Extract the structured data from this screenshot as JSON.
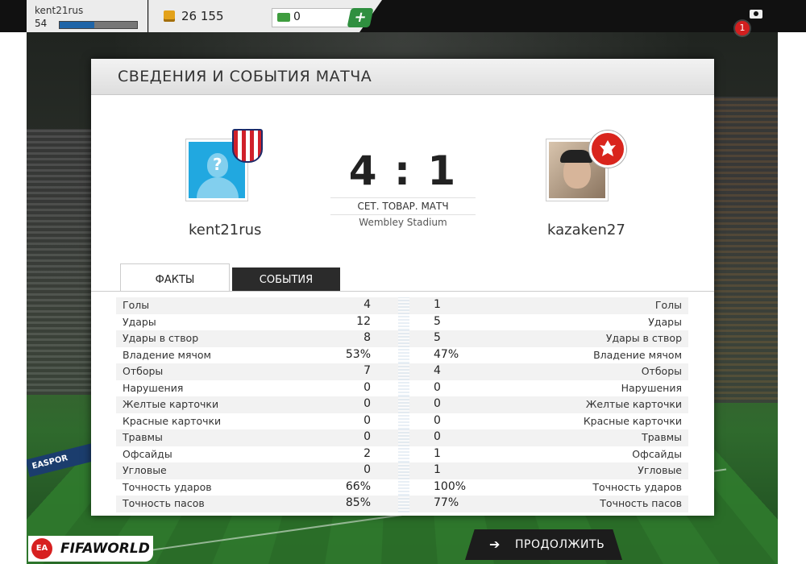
{
  "topbar": {
    "username": "kent21rus",
    "level": "54",
    "xp_fraction": 0.45,
    "coins": "26 155",
    "cash": "0",
    "add_label": "+",
    "notification_count": "1",
    "facebook_board": "EASPOR"
  },
  "panel": {
    "title": "СВЕДЕНИЯ И СОБЫТИЯ МАТЧА"
  },
  "match": {
    "home_name": "kent21rus",
    "away_name": "kazaken27",
    "score": "4 : 1",
    "match_type": "СЕТ. ТОВАР. МАТЧ",
    "stadium": "Wembley Stadium"
  },
  "tabs": {
    "facts": "ФАКТЫ",
    "events": "СОБЫТИЯ"
  },
  "stats": [
    {
      "label": "Голы",
      "home": "4",
      "away": "1"
    },
    {
      "label": "Удары",
      "home": "12",
      "away": "5"
    },
    {
      "label": "Удары в створ",
      "home": "8",
      "away": "5"
    },
    {
      "label": "Владение мячом",
      "home": "53%",
      "away": "47%"
    },
    {
      "label": "Отборы",
      "home": "7",
      "away": "4"
    },
    {
      "label": "Нарушения",
      "home": "0",
      "away": "0"
    },
    {
      "label": "Желтые карточки",
      "home": "0",
      "away": "0"
    },
    {
      "label": "Красные карточки",
      "home": "0",
      "away": "0"
    },
    {
      "label": "Травмы",
      "home": "0",
      "away": "0"
    },
    {
      "label": "Офсайды",
      "home": "2",
      "away": "1"
    },
    {
      "label": "Угловые",
      "home": "0",
      "away": "1"
    },
    {
      "label": "Точность ударов",
      "home": "66%",
      "away": "100%"
    },
    {
      "label": "Точность пасов",
      "home": "85%",
      "away": "77%"
    }
  ],
  "footer": {
    "ea_logo": "EA",
    "fifa_logo": "FIFAWORLD",
    "continue_label": "ПРОДОЛЖИТЬ",
    "continue_arrow": "➔"
  },
  "colors": {
    "xp_bar": "#1f65a8",
    "cash_button": "#2f8f3f",
    "notification": "#d21f1f"
  }
}
